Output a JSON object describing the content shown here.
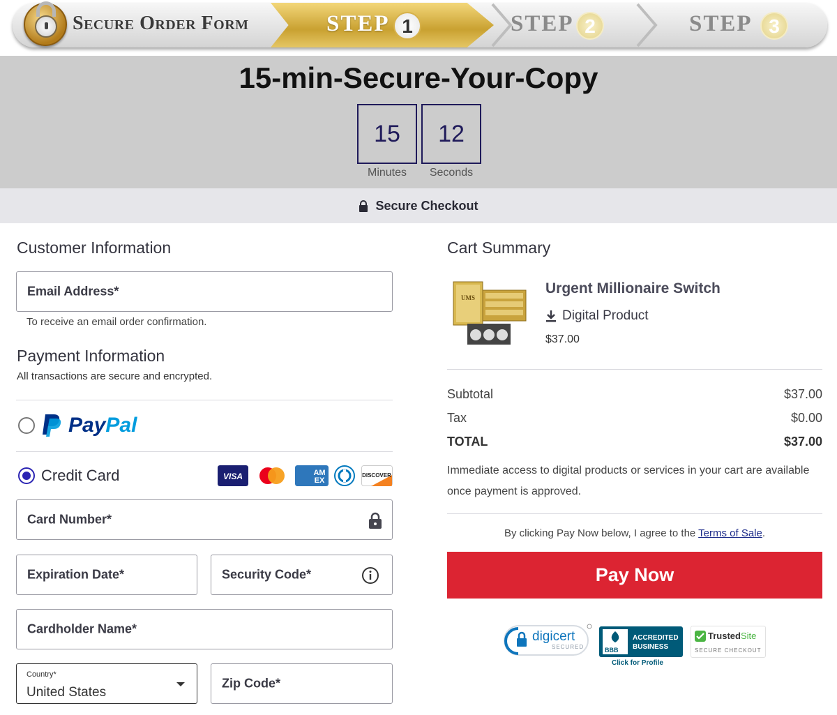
{
  "banner": {
    "title": "Secure Order Form",
    "steps": [
      {
        "label": "STEP",
        "number": "1",
        "active": true
      },
      {
        "label": "STEP",
        "number": "2",
        "active": false
      },
      {
        "label": "STEP",
        "number": "3",
        "active": false
      }
    ]
  },
  "timer": {
    "title": "15-min-Secure-Your-Copy",
    "minutes": "15",
    "seconds": "12",
    "minutes_label": "Minutes",
    "seconds_label": "Seconds"
  },
  "secure_checkout": "Secure Checkout",
  "customer": {
    "heading": "Customer Information",
    "email_label": "Email Address*",
    "email_hint": "To receive an email order confirmation."
  },
  "payment": {
    "heading": "Payment Information",
    "subheading": "All transactions are secure and encrypted.",
    "paypal_label": "PayPal",
    "credit_card_label": "Credit Card",
    "selected_method": "Credit Card",
    "card_brands": [
      "VISA",
      "Mastercard",
      "AMEX",
      "Diners",
      "DISCOVER"
    ],
    "card_number_label": "Card Number*",
    "expiration_label": "Expiration Date*",
    "security_label": "Security Code*",
    "cardholder_label": "Cardholder Name*",
    "country_label": "Country*",
    "country_value": "United States",
    "zip_label": "Zip Code*"
  },
  "cart": {
    "heading": "Cart Summary",
    "product_name": "Urgent Millionaire Switch",
    "product_type": "Digital Product",
    "product_price": "$37.00",
    "subtotal_label": "Subtotal",
    "subtotal": "$37.00",
    "tax_label": "Tax",
    "tax": "$0.00",
    "total_label": "TOTAL",
    "total": "$37.00",
    "note": "Immediate access to digital products or services in your cart are available once payment is approved.",
    "agree_prefix": "By clicking Pay Now below, I agree to the ",
    "agree_link": "Terms of Sale",
    "agree_suffix": ".",
    "pay_button": "Pay Now"
  },
  "trust": {
    "digicert": "digicert",
    "digicert_sub": "SECURED",
    "bbb_line1": "ACCREDITED",
    "bbb_line2": "BUSINESS",
    "bbb_mark": "BBB",
    "bbb_profile": "Click for Profile",
    "trustedsite_a": "Trusted",
    "trustedsite_b": "Site",
    "trustedsite_sub": "SECURE CHECKOUT"
  },
  "colors": {
    "pay_button": "#dc2432",
    "radio_selected": "#2b24b3",
    "timer_navy": "#1f1a5a",
    "paypal_dark": "#003087",
    "paypal_light": "#009cde"
  }
}
